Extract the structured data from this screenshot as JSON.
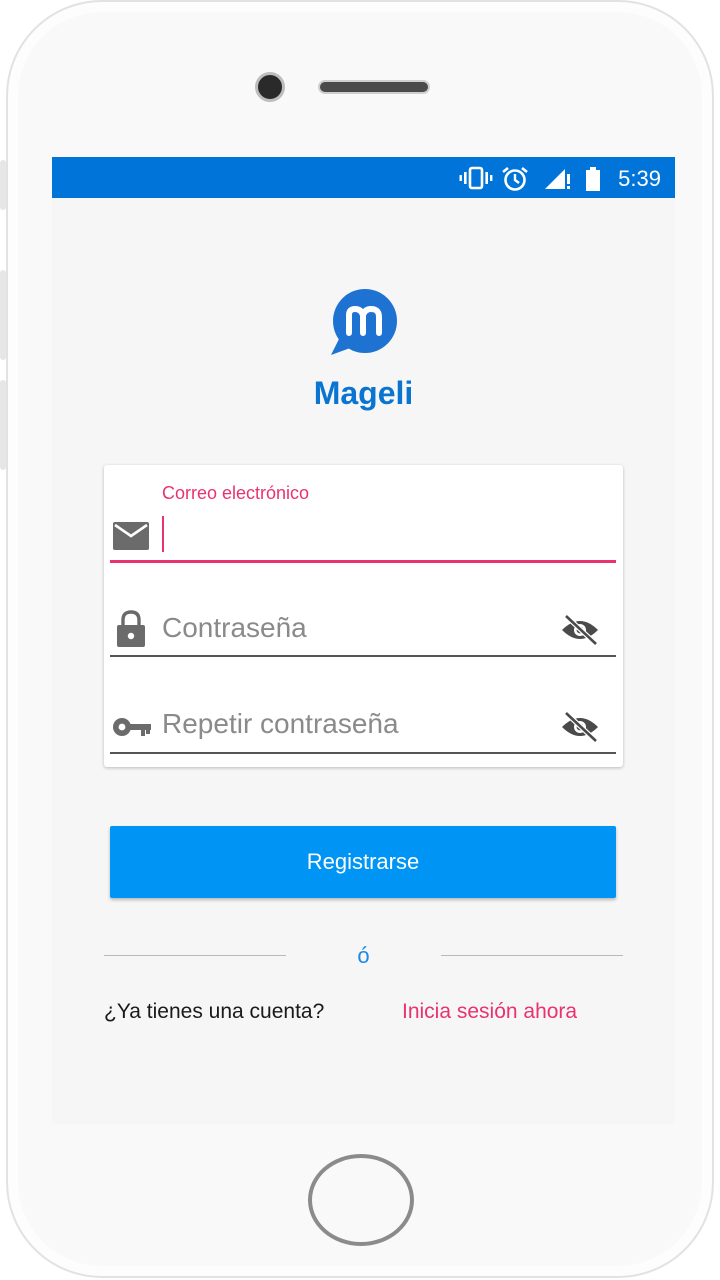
{
  "status_bar": {
    "time": "5:39",
    "icons": [
      "vibrate-icon",
      "alarm-icon",
      "signal-icon",
      "battery-icon"
    ]
  },
  "app": {
    "name": "Mageli",
    "logo_icon": "chat-bubble-m-icon"
  },
  "form": {
    "email": {
      "label": "Correo electrónico",
      "value": "",
      "icon": "mail-icon"
    },
    "password": {
      "placeholder": "Contraseña",
      "icon": "lock-icon",
      "toggle_icon": "eye-off-icon"
    },
    "repeat_password": {
      "placeholder": "Repetir contraseña",
      "icon": "key-icon",
      "toggle_icon": "eye-off-icon"
    }
  },
  "register_button": {
    "label": "Registrarse"
  },
  "separator": {
    "text": "ó"
  },
  "login_prompt": {
    "question": "¿Ya tienes una cuenta?",
    "link": "Inicia sesión ahora"
  },
  "colors": {
    "primary": "#0074d9",
    "button": "#0094f5",
    "accent": "#e8336e",
    "title": "#0a74d1"
  }
}
